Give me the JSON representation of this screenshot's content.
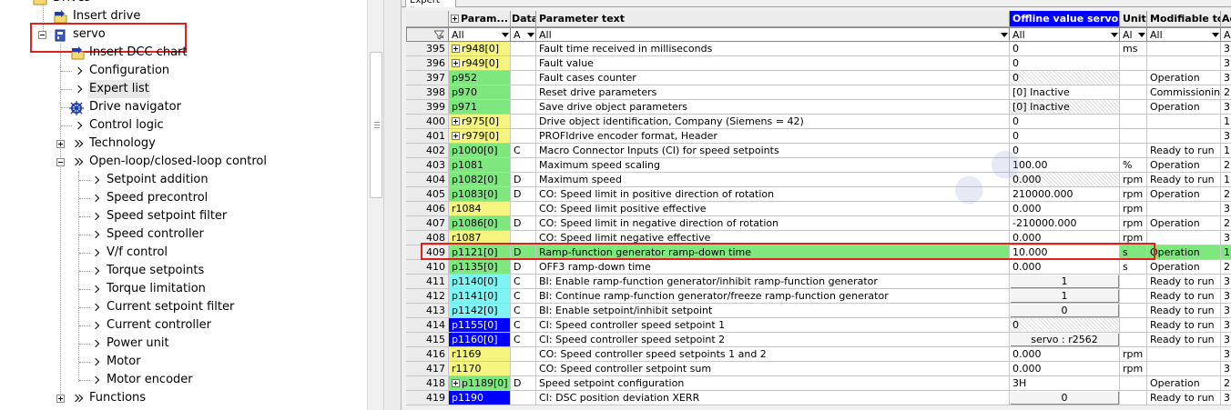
{
  "tree": {
    "drives_label": "Drives",
    "insert_drive": "Insert drive",
    "servo": "servo",
    "insert_dcc_chart": "Insert DCC chart",
    "items_level2": [
      {
        "label": "Configuration",
        "kind": "chev"
      },
      {
        "label": "Expert list",
        "kind": "chev"
      },
      {
        "label": "Drive navigator",
        "kind": "icon"
      },
      {
        "label": "Control logic",
        "kind": "chev"
      },
      {
        "label": "Technology",
        "kind": "dchev"
      },
      {
        "label": "Open-loop/closed-loop control",
        "kind": "dchev"
      }
    ],
    "items_level3": [
      "Setpoint addition",
      "Speed precontrol",
      "Speed setpoint filter",
      "Speed controller",
      "V/f control",
      "Torque setpoints",
      "Torque limitation",
      "Current setpoint filter",
      "Current controller",
      "Power unit",
      "Motor",
      "Motor encoder"
    ],
    "functions": "Functions"
  },
  "tab": {
    "label": "Expert list"
  },
  "table": {
    "headers": {
      "param": "Param...",
      "data": "Data",
      "text": "Parameter text",
      "value": "Offline value servo",
      "unit": "Unit",
      "mod": "Modifiable to",
      "acc": "Ac"
    },
    "filters": {
      "param": "All",
      "data": "A",
      "text": "All",
      "value": "All",
      "unit": "Al",
      "mod": "All",
      "acc": "A"
    },
    "rows": [
      {
        "n": "395",
        "p": "r948[0]",
        "exp": true,
        "pc": "yellow",
        "d": "",
        "t": "Fault time received in milliseconds",
        "v": "0",
        "vs": "",
        "u": "ms",
        "m": "",
        "a": "3",
        "hl": false
      },
      {
        "n": "396",
        "p": "r949[0]",
        "exp": true,
        "pc": "yellow",
        "d": "",
        "t": "Fault value",
        "v": "0",
        "vs": "",
        "u": "",
        "m": "",
        "a": "3",
        "hl": false
      },
      {
        "n": "397",
        "p": "p952",
        "exp": false,
        "pc": "green",
        "d": "",
        "t": "Fault cases counter",
        "v": "0",
        "vs": "hatched",
        "u": "",
        "m": "Operation",
        "a": "3",
        "hl": false
      },
      {
        "n": "398",
        "p": "p970",
        "exp": false,
        "pc": "green",
        "d": "",
        "t": "Reset drive parameters",
        "v": "[0] Inactive",
        "vs": "",
        "u": "",
        "m": "Commissionin...",
        "a": "2",
        "hl": false
      },
      {
        "n": "399",
        "p": "p971",
        "exp": false,
        "pc": "green",
        "d": "",
        "t": "Save drive object parameters",
        "v": "[0] Inactive",
        "vs": "hatched",
        "u": "",
        "m": "Operation",
        "a": "3",
        "hl": false
      },
      {
        "n": "400",
        "p": "r975[0]",
        "exp": true,
        "pc": "yellow",
        "d": "",
        "t": "Drive object identification, Company (Siemens = 42)",
        "v": "0",
        "vs": "",
        "u": "",
        "m": "",
        "a": "1",
        "hl": false
      },
      {
        "n": "401",
        "p": "r979[0]",
        "exp": true,
        "pc": "yellow",
        "d": "",
        "t": "PROFIdrive encoder format, Header",
        "v": "0",
        "vs": "",
        "u": "",
        "m": "",
        "a": "3",
        "hl": false
      },
      {
        "n": "402",
        "p": "p1000[0]",
        "exp": false,
        "pc": "green",
        "d": "C",
        "t": "Macro Connector Inputs (CI) for speed setpoints",
        "v": "0",
        "vs": "",
        "u": "",
        "m": "Ready to run",
        "a": "1",
        "hl": false
      },
      {
        "n": "403",
        "p": "p1081",
        "exp": false,
        "pc": "green",
        "d": "",
        "t": "Maximum speed scaling",
        "v": "100.00",
        "vs": "",
        "u": "%",
        "m": "Operation",
        "a": "2",
        "hl": false
      },
      {
        "n": "404",
        "p": "p1082[0]",
        "exp": false,
        "pc": "green",
        "d": "D",
        "t": "Maximum speed",
        "v": "0.000",
        "vs": "hatched",
        "u": "rpm",
        "m": "Ready to run",
        "a": "1",
        "hl": false
      },
      {
        "n": "405",
        "p": "p1083[0]",
        "exp": false,
        "pc": "green",
        "d": "D",
        "t": "CO: Speed limit in positive direction of rotation",
        "v": "210000.000",
        "vs": "",
        "u": "rpm",
        "m": "Operation",
        "a": "2",
        "hl": false
      },
      {
        "n": "406",
        "p": "r1084",
        "exp": false,
        "pc": "yellow",
        "d": "",
        "t": "CO: Speed limit positive effective",
        "v": "0.000",
        "vs": "",
        "u": "rpm",
        "m": "",
        "a": "3",
        "hl": false
      },
      {
        "n": "407",
        "p": "p1086[0]",
        "exp": false,
        "pc": "green",
        "d": "D",
        "t": "CO: Speed limit in negative direction of rotation",
        "v": "-210000.000",
        "vs": "",
        "u": "rpm",
        "m": "Operation",
        "a": "2",
        "hl": false
      },
      {
        "n": "408",
        "p": "r1087",
        "exp": false,
        "pc": "yellow",
        "d": "",
        "t": "CO: Speed limit negative effective",
        "v": "0.000",
        "vs": "",
        "u": "rpm",
        "m": "",
        "a": "3",
        "hl": false
      },
      {
        "n": "409",
        "p": "p1121[0]",
        "exp": false,
        "pc": "green",
        "d": "D",
        "t": "Ramp-function generator ramp-down time",
        "v": "10.000",
        "vs": "",
        "u": "s",
        "m": "Operation",
        "a": "1",
        "hl": true
      },
      {
        "n": "410",
        "p": "p1135[0]",
        "exp": false,
        "pc": "green",
        "d": "D",
        "t": "OFF3 ramp-down time",
        "v": "0.000",
        "vs": "",
        "u": "s",
        "m": "Operation",
        "a": "2",
        "hl": false
      },
      {
        "n": "411",
        "p": "p1140[0]",
        "exp": false,
        "pc": "cyan",
        "d": "C",
        "t": "BI: Enable ramp-function generator/inhibit ramp-function generator",
        "v": "1",
        "vs": "box",
        "u": "",
        "m": "Ready to run",
        "a": "3",
        "hl": false
      },
      {
        "n": "412",
        "p": "p1141[0]",
        "exp": false,
        "pc": "cyan",
        "d": "C",
        "t": "BI: Continue ramp-function generator/freeze ramp-function generator",
        "v": "1",
        "vs": "box",
        "u": "",
        "m": "Ready to run",
        "a": "3",
        "hl": false
      },
      {
        "n": "413",
        "p": "p1142[0]",
        "exp": false,
        "pc": "cyan",
        "d": "C",
        "t": "BI: Enable setpoint/inhibit setpoint",
        "v": "0",
        "vs": "box",
        "u": "",
        "m": "Ready to run",
        "a": "3",
        "hl": false
      },
      {
        "n": "414",
        "p": "p1155[0]",
        "exp": false,
        "pc": "blue",
        "d": "C",
        "t": "CI: Speed controller speed setpoint 1",
        "v": "0",
        "vs": "hatched",
        "u": "",
        "m": "Ready to run",
        "a": "3",
        "hl": false
      },
      {
        "n": "415",
        "p": "p1160[0]",
        "exp": false,
        "pc": "blue",
        "d": "C",
        "t": "CI: Speed controller speed setpoint 2",
        "v": "servo : r2562",
        "vs": "box",
        "u": "",
        "m": "Ready to run",
        "a": "3",
        "hl": false
      },
      {
        "n": "416",
        "p": "r1169",
        "exp": false,
        "pc": "yellow",
        "d": "",
        "t": "CO: Speed controller speed setpoints 1 and 2",
        "v": "0.000",
        "vs": "",
        "u": "rpm",
        "m": "",
        "a": "3",
        "hl": false
      },
      {
        "n": "417",
        "p": "r1170",
        "exp": false,
        "pc": "yellow",
        "d": "",
        "t": "CO: Speed controller setpoint sum",
        "v": "0.000",
        "vs": "",
        "u": "rpm",
        "m": "",
        "a": "3",
        "hl": false
      },
      {
        "n": "418",
        "p": "p1189[0]",
        "exp": true,
        "pc": "green",
        "d": "D",
        "t": "Speed setpoint configuration",
        "v": "3H",
        "vs": "",
        "u": "",
        "m": "Operation",
        "a": "2",
        "hl": false
      },
      {
        "n": "419",
        "p": "p1190",
        "exp": false,
        "pc": "blue",
        "d": "",
        "t": "CI: DSC position deviation XERR",
        "v": "0",
        "vs": "box",
        "u": "",
        "m": "Ready to run",
        "a": "3",
        "hl": false
      }
    ]
  },
  "colors": {
    "green": "#7ee87e",
    "yellow": "#f4f47e",
    "cyan": "#7ef4f4",
    "blue": "#0000ff",
    "highlight_box": "#e0201b",
    "value_header": "#0000ff"
  }
}
